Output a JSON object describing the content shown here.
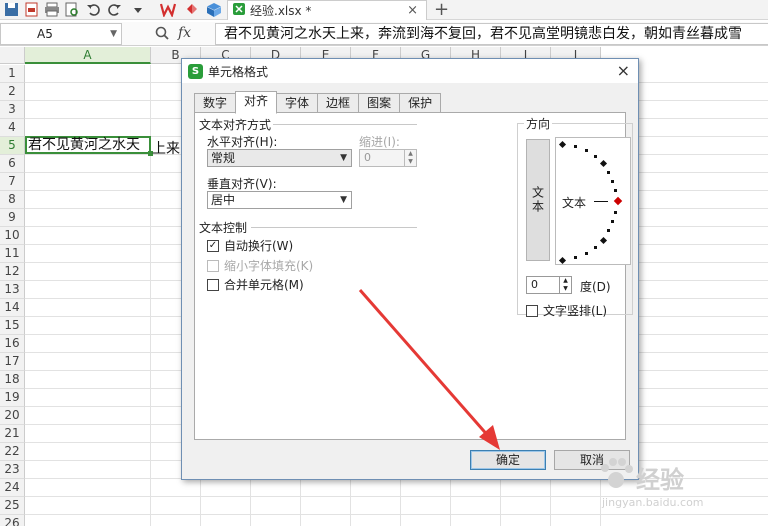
{
  "app": {
    "file_tab": "经验.xlsx *",
    "file_tab_close": "×",
    "new_tab": "+"
  },
  "formula_bar": {
    "name_box": "A5",
    "fx": "fx",
    "formula": "君不见黄河之水天上来，奔流到海不复回，君不见高堂明镜悲白发，朝如青丝暮成雪"
  },
  "sheet": {
    "columns": [
      "A",
      "B",
      "C",
      "D",
      "E",
      "F",
      "G",
      "H",
      "I",
      "J"
    ],
    "rows": [
      "1",
      "2",
      "3",
      "4",
      "5",
      "6",
      "7",
      "8",
      "9",
      "10",
      "11",
      "12",
      "13",
      "14",
      "15",
      "16",
      "17",
      "18",
      "19",
      "20",
      "21",
      "22",
      "23",
      "24",
      "25",
      "26"
    ],
    "cell_a5": "君不见黄河之水天",
    "overflow_text": "上来，",
    "selected_col": "A",
    "selected_row": "5"
  },
  "dialog": {
    "title": "单元格格式",
    "tabs": [
      "数字",
      "对齐",
      "字体",
      "边框",
      "图案",
      "保护"
    ],
    "active_tab": "对齐",
    "text_align": {
      "group": "文本对齐方式",
      "horizontal_label": "水平对齐(H):",
      "horizontal_value": "常规",
      "indent_label": "缩进(I):",
      "indent_value": "0",
      "vertical_label": "垂直对齐(V):",
      "vertical_value": "居中"
    },
    "text_control": {
      "group": "文本控制",
      "wrap": "自动换行(W)",
      "wrap_checked": true,
      "shrink": "缩小字体填充(K)",
      "shrink_disabled": true,
      "merge": "合并单元格(M)",
      "merge_checked": false
    },
    "orientation": {
      "group": "方向",
      "vertical_text": "文本",
      "dial_text": "文本",
      "degrees_value": "0",
      "degrees_label": "度(D)",
      "stack": "文字竖排(L)",
      "stack_checked": false
    },
    "ok": "确定",
    "cancel": "取消",
    "close": "×"
  },
  "watermark": {
    "text": "经验",
    "url": "jingyan.baidu.com"
  },
  "colors": {
    "accent": "#3a8f3a",
    "arrow": "#e53935"
  }
}
